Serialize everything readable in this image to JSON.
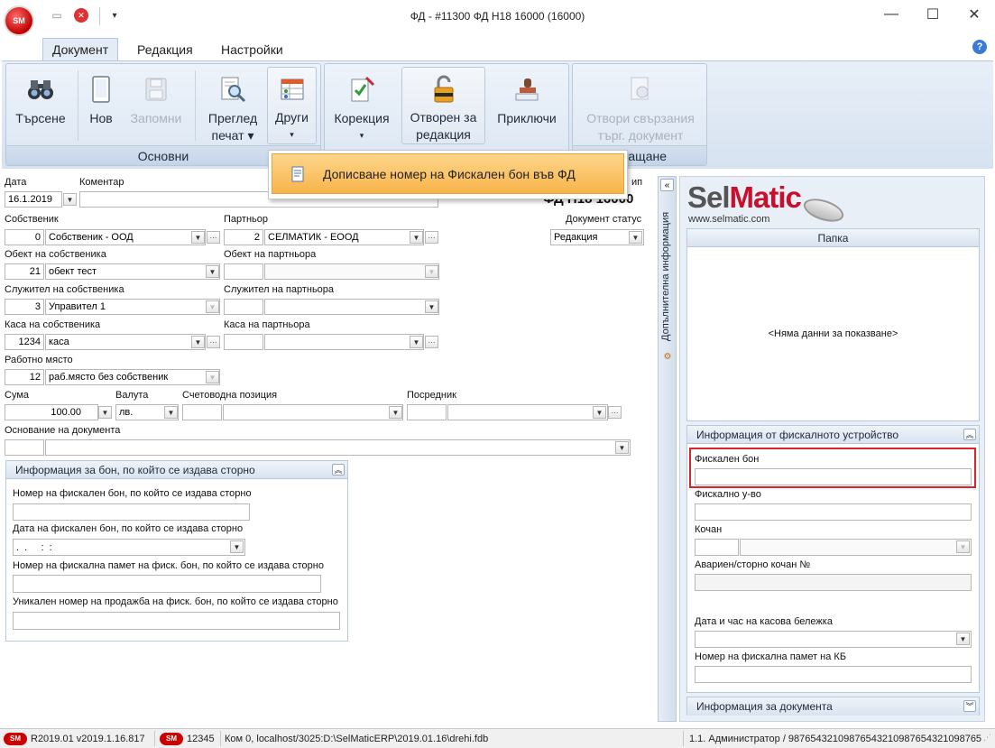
{
  "app": {
    "logo": "SM",
    "title": "ФД - #11300 ФД Н18 16000 (16000)"
  },
  "window": {
    "minimize": "—",
    "maximize": "☐",
    "close": "✕"
  },
  "tabs": [
    {
      "label": "Документ"
    },
    {
      "label": "Редакция"
    },
    {
      "label": "Настройки"
    }
  ],
  "help": "?",
  "ribbon": {
    "search": "Търсене",
    "new": "Нов",
    "save": "Запомни",
    "preview_l1": "Преглед",
    "preview_l2": "печат ▾",
    "other_l1": "Други",
    "other_l2": "▾",
    "group_main": "Основни",
    "correction_l1": "Корекция",
    "correction_l2": "▾",
    "open_l1": "Отворен за",
    "open_l2": "редакция",
    "finish": "Приключи",
    "linked_l1": "Отвори свързания",
    "linked_l2": "търг. документ",
    "group_right_tail": "ащане"
  },
  "popup": {
    "item": "Дописване номер на Фискален бон във ФД"
  },
  "form": {
    "date_label": "Дата",
    "date_value": "16.1.2019",
    "comment_label": "Коментар",
    "type_label_tail": "ип",
    "doc_code_tail": "ФД Н18 16000",
    "owner_label": "Собственик",
    "owner_id": "0",
    "owner_name": "Собственик - ООД",
    "partner_label": "Партньор",
    "partner_id": "2",
    "partner_name": "СЕЛМАТИК - ЕООД",
    "status_label": "Документ статус",
    "status_value": "Редакция",
    "object_label": "Обект на собственика",
    "object_id": "21",
    "object_name": "обект тест",
    "pobject_label": "Обект на партньора",
    "employee_label": "Служител на собственика",
    "employee_id": "3",
    "employee_name": "Управител 1",
    "pemployee_label": "Служител на партньора",
    "cash_label": "Каса на собственика",
    "cash_id": "1234",
    "cash_name": "каса",
    "pcash_label": "Каса на партньора",
    "workplace_label": "Работно място",
    "workplace_id": "12",
    "workplace_name": "раб.място без собственик",
    "sum_label": "Сума",
    "sum_value": "100.00",
    "currency_label": "Валута",
    "currency_value": "лв.",
    "accpos_label": "Счетоводна позиция",
    "broker_label": "Посредник",
    "basis_label": "Основание на документа"
  },
  "storno": {
    "header": "Информация за бон, по който се издава сторно",
    "f1_label": "Номер на фискален бон, по който се издава сторно",
    "f2_label": "Дата на фискален бон, по който се издава сторно",
    "f2_value": ".  .     :  :",
    "f3_label": "Номер на фискална памет на фиск. бон, по който се издава сторно",
    "f4_label": "Уникален номер на продажба на фиск. бон, по който се издава сторно"
  },
  "side": {
    "collapse": "«",
    "vertical_label": "Допълнителна информация",
    "brand": "SelMatic",
    "brand_url": "www.selmatic.com",
    "folder_header": "Папка",
    "no_data": "<Няма данни за показване>",
    "fiscal_header": "Информация от фискалното устройство",
    "fiscal_receipt_label": "Фискален бон",
    "fiscal_device_label": "Фискално у-во",
    "book_label": "Кочан",
    "emergency_label": "Авариен/сторно кочан №",
    "datetime_label": "Дата и час на касова бележка",
    "fiscal_memory_label": "Номер на фискална памет на КБ",
    "doc_info_header": "Информация за документа"
  },
  "status": {
    "logo": "SM",
    "version": "R2019.01 v2019.1.16.817",
    "cell2": "12345",
    "connection": "Ком 0, localhost/3025:D:\\SelMaticERP\\2019.01.16\\drehi.fdb",
    "user": "1.1. Администратор / 98765432109876543210987654321098765"
  },
  "colors": {
    "accent": "#1e2a3a",
    "popup": "#f9b44a",
    "highlight": "#d9232d",
    "brand_red": "#c8102e"
  }
}
